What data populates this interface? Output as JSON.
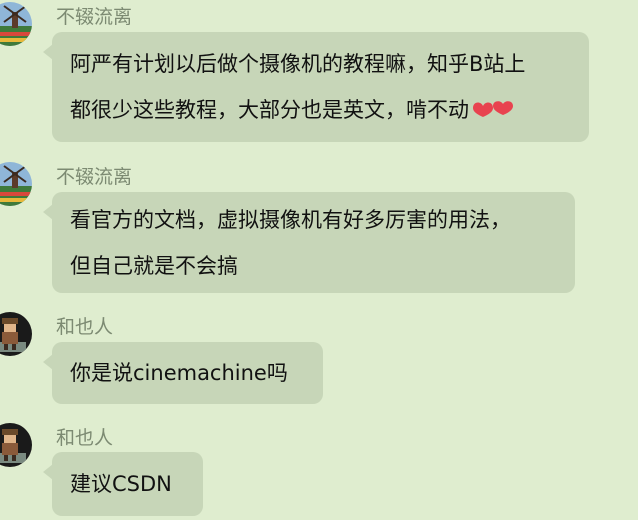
{
  "messages": [
    {
      "sender": "不辍流离",
      "avatar_icon": "windmill-landscape-icon",
      "lines": [
        "阿严有计划以后做个摄像机的教程嘛，知乎B站上",
        "都很少这些教程，大部分也是英文，啃不动"
      ],
      "trailing_emoji": "heart-icon"
    },
    {
      "sender": "不辍流离",
      "avatar_icon": "windmill-landscape-icon",
      "lines": [
        "看官方的文档，虚拟摄像机有好多厉害的用法，",
        "但自己就是不会搞"
      ]
    },
    {
      "sender": "和也人",
      "avatar_icon": "pixel-character-icon",
      "lines": [
        "你是说cinemachine吗"
      ]
    },
    {
      "sender": "和也人",
      "avatar_icon": "pixel-character-icon",
      "lines": [
        "建议CSDN"
      ]
    }
  ],
  "colors": {
    "background": "#dfedcf",
    "bubble": "#c7d6b8",
    "sender_name": "#7c8a72",
    "text": "#111111",
    "emoji": "#e8434f"
  }
}
